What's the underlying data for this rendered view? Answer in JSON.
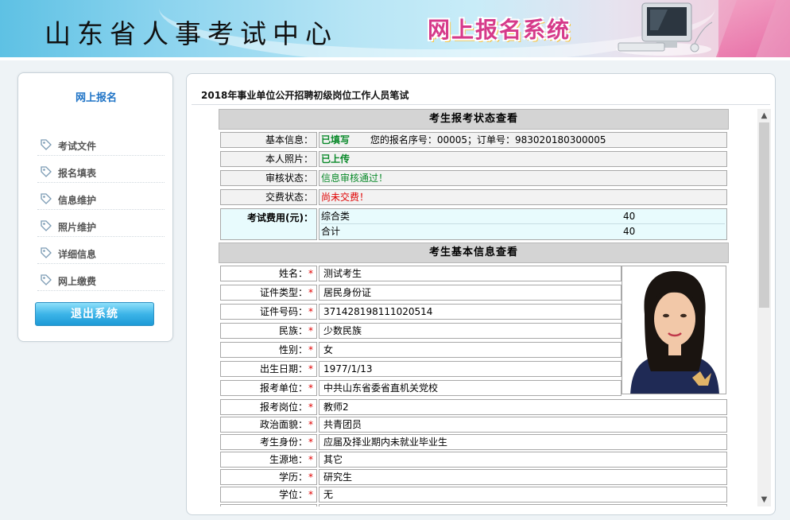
{
  "header": {
    "title": "山东省人事考试中心",
    "brand": "网上报名系统"
  },
  "sidebar": {
    "title": "网上报名",
    "items": [
      {
        "label": "考试文件",
        "icon": "tag-icon"
      },
      {
        "label": "报名填表",
        "icon": "tag-icon"
      },
      {
        "label": "信息维护",
        "icon": "tag-icon"
      },
      {
        "label": "照片维护",
        "icon": "tag-icon"
      },
      {
        "label": "详细信息",
        "icon": "tag-icon"
      },
      {
        "label": "网上缴费",
        "icon": "tag-icon"
      }
    ],
    "logout_label": "退出系统"
  },
  "main": {
    "panel_title": "2018年事业单位公开招聘初级岗位工作人员笔试",
    "status_section": {
      "title": "考生报考状态查看",
      "basic_label": "基本信息：",
      "basic_value": "已填写",
      "basic_extra": "您的报名序号：00005；订单号：983020180300005",
      "photo_label": "本人照片：",
      "photo_value": "已上传",
      "review_label": "审核状态：",
      "review_value": "信息审核通过！",
      "payment_label": "交费状态：",
      "payment_value": "尚未交费！",
      "fee_label": "考试费用(元)：",
      "fees": [
        {
          "name": "综合类",
          "amount": "40"
        },
        {
          "name": "合计",
          "amount": "40"
        }
      ]
    },
    "info_section": {
      "title": "考生基本信息查看",
      "fields": [
        {
          "label": "姓名：",
          "value": "测试考生"
        },
        {
          "label": "证件类型：",
          "value": "居民身份证"
        },
        {
          "label": "证件号码：",
          "value": "371428198111020514"
        },
        {
          "label": "民族：",
          "value": "少数民族"
        },
        {
          "label": "性别：",
          "value": "女"
        },
        {
          "label": "出生日期：",
          "value": "1977/1/13"
        },
        {
          "label": "报考单位：",
          "value": "中共山东省委省直机关党校"
        },
        {
          "label": "报考岗位：",
          "value": "教师2"
        },
        {
          "label": "政治面貌：",
          "value": "共青团员"
        },
        {
          "label": "考生身份：",
          "value": "应届及择业期内未就业毕业生"
        },
        {
          "label": "生源地：",
          "value": "其它"
        },
        {
          "label": "学历：",
          "value": "研究生"
        },
        {
          "label": "学位：",
          "value": "无"
        }
      ],
      "required_mark": "*"
    }
  },
  "colors": {
    "accent": "#1e73c6",
    "ok": "#0b8a2b",
    "warn": "#e00000",
    "button": "#3cb4e8"
  }
}
